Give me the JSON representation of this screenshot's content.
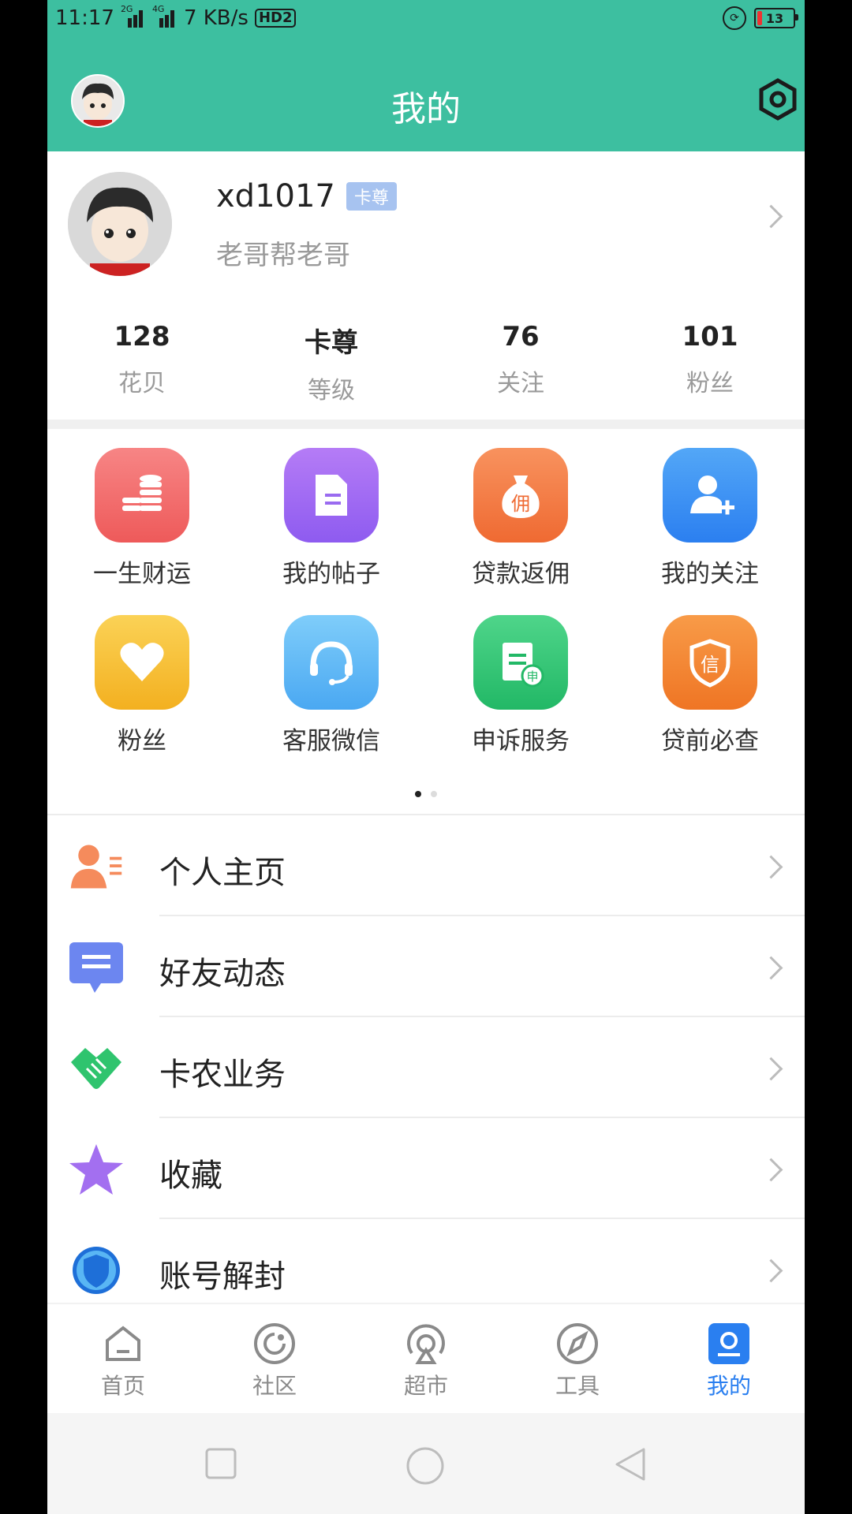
{
  "statusbar": {
    "time": "11:17",
    "net": "2G",
    "net2": "4G",
    "speed": "7 KB/s",
    "hd": "HD2",
    "battery": "13"
  },
  "header": {
    "title": "我的"
  },
  "profile": {
    "username": "xd1017",
    "badge": "卡尊",
    "signature": "老哥帮老哥",
    "stats": [
      {
        "value": "128",
        "label": "花贝"
      },
      {
        "value": "卡尊",
        "label": "等级"
      },
      {
        "value": "76",
        "label": "关注"
      },
      {
        "value": "101",
        "label": "粉丝"
      }
    ]
  },
  "grid": [
    {
      "label": "一生财运",
      "icon": "coins-icon",
      "color": "#f26b6b"
    },
    {
      "label": "我的帖子",
      "icon": "document-icon",
      "color": "#9a6bf0"
    },
    {
      "label": "贷款返佣",
      "icon": "money-bag-icon",
      "color": "#f47b45"
    },
    {
      "label": "我的关注",
      "icon": "add-user-icon",
      "color": "#3b8ff0"
    },
    {
      "label": "粉丝",
      "icon": "heart-icon",
      "color": "#f6be35"
    },
    {
      "label": "客服微信",
      "icon": "headset-icon",
      "color": "#59b6f4"
    },
    {
      "label": "申诉服务",
      "icon": "clipboard-icon",
      "color": "#31c476"
    },
    {
      "label": "贷前必查",
      "icon": "shield-icon",
      "color": "#f3862f"
    }
  ],
  "list": [
    {
      "label": "个人主页",
      "icon": "person-icon"
    },
    {
      "label": "好友动态",
      "icon": "message-icon"
    },
    {
      "label": "卡农业务",
      "icon": "handshake-icon"
    },
    {
      "label": "收藏",
      "icon": "star-icon"
    },
    {
      "label": "账号解封",
      "icon": "shield-badge-icon"
    }
  ],
  "tabs": [
    {
      "label": "首页",
      "icon": "home-icon"
    },
    {
      "label": "社区",
      "icon": "community-icon"
    },
    {
      "label": "超市",
      "icon": "market-icon"
    },
    {
      "label": "工具",
      "icon": "compass-icon"
    },
    {
      "label": "我的",
      "icon": "profile-icon",
      "active": true
    }
  ],
  "colors": {
    "primary": "#3dbfa0",
    "active_tab": "#2a7ff0"
  }
}
